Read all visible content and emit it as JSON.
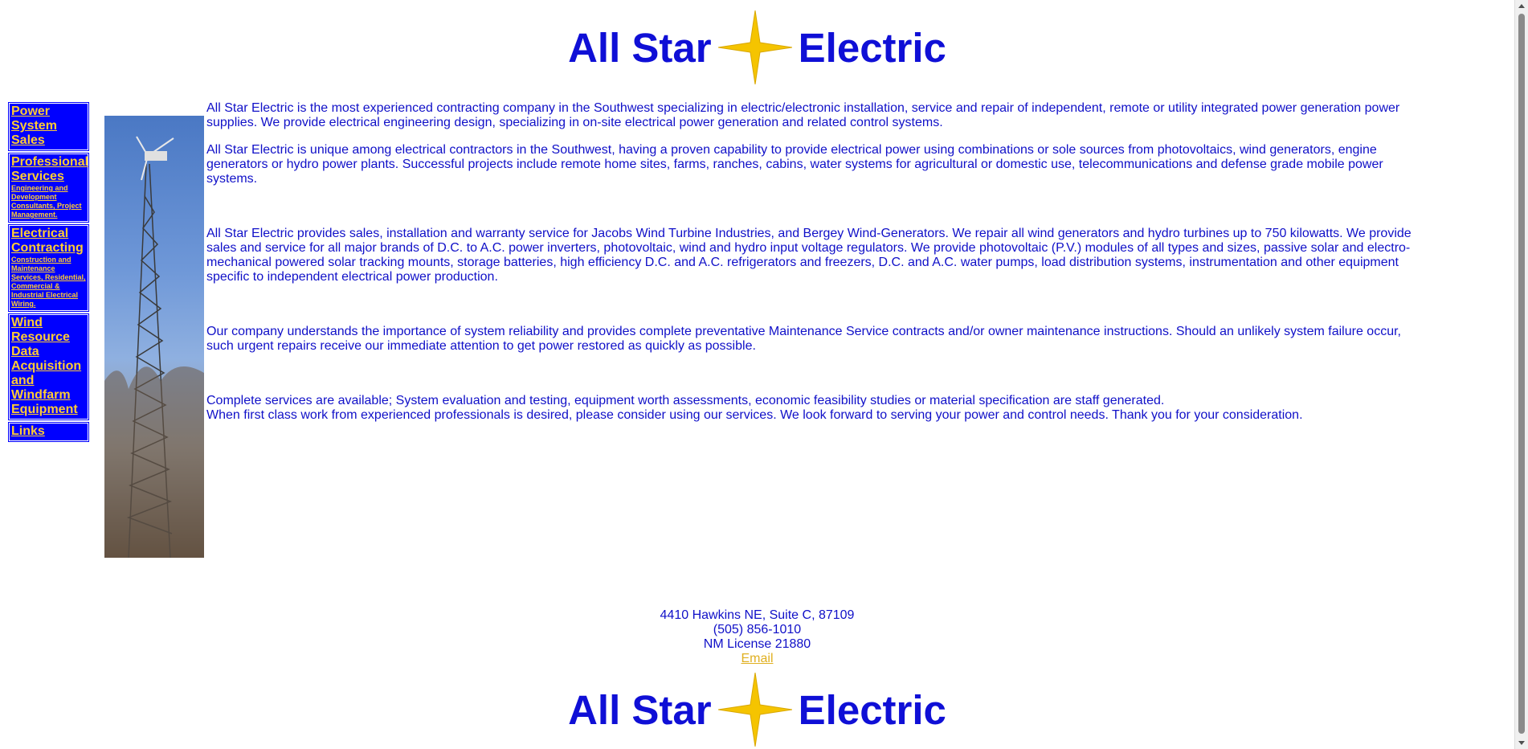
{
  "header": {
    "logo_left": "All Star",
    "logo_right": "Electric",
    "logo_icon": "star-icon"
  },
  "sidebar": {
    "items": [
      {
        "label": "Power System Sales",
        "sub": ""
      },
      {
        "label": "Professional Services",
        "sub": "Engineering and Development Consultants, Project Management."
      },
      {
        "label": "Electrical Contracting",
        "sub": "Construction and Maintenance Services, Residential, Commercial & Industrial Electrical Wiring."
      },
      {
        "label": "Wind Resource Data Acquisition and Windfarm Equipment",
        "sub": ""
      },
      {
        "label": "Links",
        "sub": ""
      }
    ]
  },
  "main": {
    "image": "wind-turbine-tower-photo",
    "paragraphs": [
      "All Star Electric is the most experienced contracting company in the Southwest specializing in electric/electronic installation, service and repair of independent, remote or utility integrated power generation power supplies. We provide electrical engineering design, specializing in on-site electrical power generation and related control systems.",
      "All Star Electric is unique among electrical contractors in the Southwest, having a proven capability to provide electrical power using combinations or sole sources from photovoltaics, wind generators, engine generators or hydro power plants. Successful projects include remote home sites, farms, ranches, cabins, water systems for agricultural or domestic use, telecommunications and defense grade mobile power systems.",
      "All Star Electric provides sales, installation and warranty service for Jacobs Wind Turbine Industries, and Bergey Wind-Generators. We repair all wind generators and hydro turbines up to 750 kilowatts. We provide sales and service for all major brands of D.C. to A.C. power inverters, photovoltaic, wind and hydro input voltage regulators. We provide photovoltaic (P.V.) modules of all types and sizes, passive solar and electro-mechanical powered solar tracking mounts, storage batteries, high efficiency D.C. and A.C. refrigerators and freezers, D.C. and A.C. water pumps, load distribution systems, instrumentation and other equipment specific to independent electrical power production.",
      "Our company understands the importance of system reliability and provides complete preventative Maintenance Service contracts and/or owner maintenance instructions. Should an unlikely system failure occur, such urgent repairs receive our immediate attention to get power restored as quickly as possible.",
      "Complete services are available; System evaluation and testing, equipment worth assessments, economic feasibility studies or material specification are staff generated.",
      "When first class work from experienced professionals is desired, please consider using our services. We look forward to serving your power and control needs. Thank you for your consideration."
    ]
  },
  "footer": {
    "address": "4410 Hawkins NE, Suite C, 87109",
    "phone": "(505) 856-1010",
    "license": "NM License 21880",
    "email_link": "Email"
  },
  "colors": {
    "brand_blue": "#0f0fd6",
    "nav_bg": "#0000ff",
    "nav_link": "#ffcc33",
    "star_fill": "#f5c400"
  }
}
